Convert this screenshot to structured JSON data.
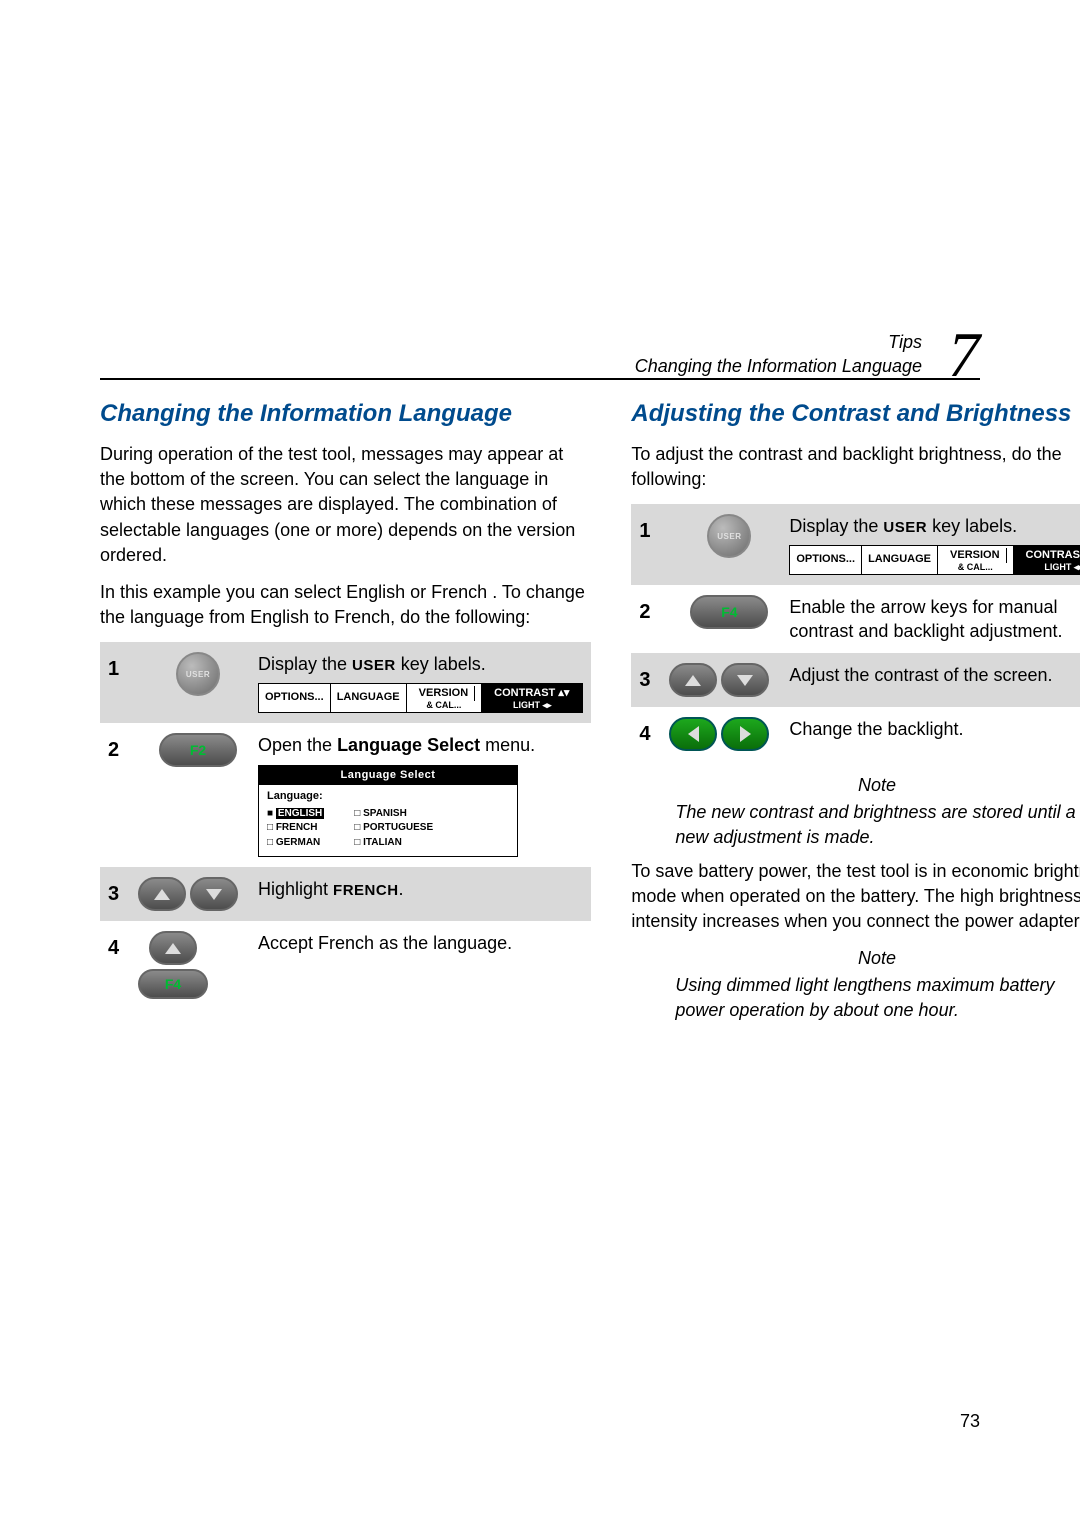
{
  "header": {
    "category": "Tips",
    "subtitle": "Changing the Information Language",
    "chapter_number": "7"
  },
  "left": {
    "heading": "Changing the Information Language",
    "intro1": "During operation of the test tool, messages may appear at the bottom of the screen. You can select the language in which these messages are displayed. The combination of selectable languages (one or more) depends on the version ordered.",
    "intro2": "In this example you can select English or French . To change the language from English to French, do the following:",
    "steps": {
      "s1": {
        "num": "1",
        "key_label": "USER",
        "text_a": "Display the ",
        "text_key": "USER",
        "text_b": " key labels.",
        "softkeys": {
          "k1": "OPTIONS...",
          "k2": "LANGUAGE",
          "k3a": "VERSION",
          "k3b": "& CAL...",
          "k4a": "CONTRAST ▴▾",
          "k4b": "LIGHT ◂▸"
        }
      },
      "s2": {
        "num": "2",
        "key_label": "F2",
        "text_a": "Open the ",
        "text_bold": "Language Select",
        "text_b": " menu.",
        "menu": {
          "title": "Language Select",
          "label": "Language:",
          "col1": {
            "o1": "ENGLISH",
            "o2": "FRENCH",
            "o3": "GERMAN"
          },
          "col2": {
            "o1": "SPANISH",
            "o2": "PORTUGUESE",
            "o3": "ITALIAN"
          }
        }
      },
      "s3": {
        "num": "3",
        "text_a": "Highlight ",
        "text_key": "FRENCH",
        "text_b": "."
      },
      "s4": {
        "num": "4",
        "key_label": "F4",
        "text": "Accept French as the language."
      }
    }
  },
  "right": {
    "heading": "Adjusting the Contrast and Brightness",
    "intro": "To adjust the contrast and backlight brightness, do the following:",
    "steps": {
      "s1": {
        "num": "1",
        "key_label": "USER",
        "text_a": "Display the ",
        "text_key": "USER",
        "text_b": " key labels.",
        "softkeys": {
          "k1": "OPTIONS...",
          "k2": "LANGUAGE",
          "k3a": "VERSION",
          "k3b": "& CAL...",
          "k4a": "CONTRAST ▴▾",
          "k4b": "LIGHT ◂▸"
        }
      },
      "s2": {
        "num": "2",
        "key_label": "F4",
        "text": "Enable the arrow keys for manual contrast and backlight adjustment."
      },
      "s3": {
        "num": "3",
        "text": "Adjust the contrast of the screen."
      },
      "s4": {
        "num": "4",
        "text": "Change the backlight."
      }
    },
    "note1_title": "Note",
    "note1": "The new contrast and brightness are stored until a new adjustment is made.",
    "para": "To save battery power, the test tool is in economic brightness mode when operated on the battery. The high brightness intensity increases when you connect the power adapter.",
    "note2_title": "Note",
    "note2": "Using dimmed light lengthens maximum battery power operation by about one hour."
  },
  "page_number": "73"
}
